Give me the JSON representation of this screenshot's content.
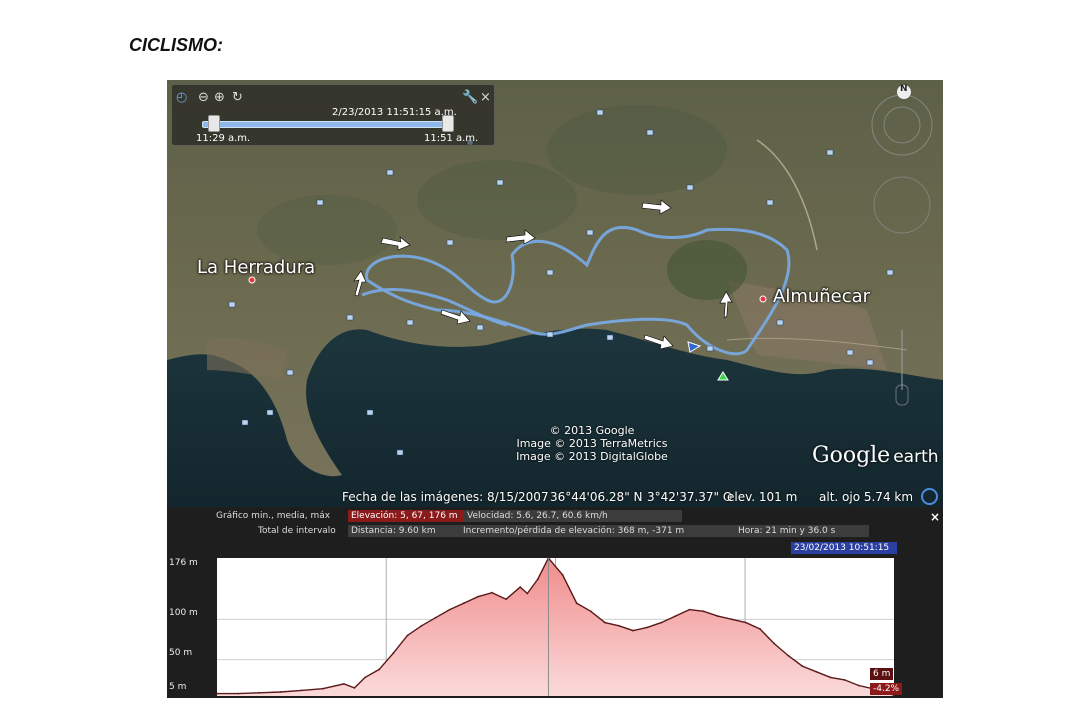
{
  "heading": "CICLISMO:",
  "time_slider": {
    "current": "2/23/2013  11:51:15 a.m.",
    "start": "11:29 a.m.",
    "end": "11:51 a.m."
  },
  "map": {
    "places": [
      "La Herradura",
      "Almuñecar"
    ],
    "copyright": [
      "© 2013 Google",
      "Image © 2013 TerraMetrics",
      "Image © 2013 DigitalGlobe"
    ],
    "logo_word": "Google",
    "logo_earth": "earth",
    "compass": "N",
    "status": {
      "imagery_date": "Fecha de las imágenes: 8/15/2007",
      "lat": "36°44'06.28\" N",
      "lon": "3°42'37.37\" O",
      "elev": "elev.   101 m",
      "eye": "alt. ojo   5.74 km"
    },
    "icons": [
      "zoom-out-icon",
      "zoom-in-icon",
      "zoom-reset-icon",
      "wrench-icon",
      "close-icon"
    ]
  },
  "elevation_panel": {
    "row1_label": "Gráfico  min., media, máx",
    "elevation": "Elevación: 5, 67, 176 m",
    "speed": "Velocidad: 5.6, 26.7, 60.6 km/h",
    "row2_label": "Total de intervalo",
    "distance": "Distancia: 9.60 km",
    "gain_loss": "Incremento/pérdida de elevación: 368 m, -371 m",
    "time": "Hora: 21 min y 36.0 s",
    "timestamp": "23/02/2013 10:51:15",
    "close": "×",
    "y_labels": [
      "176 m",
      "100 m",
      "50 m",
      "5 m"
    ],
    "end_elev": "6 m",
    "end_grade": "-4.2%"
  },
  "chart_data": {
    "type": "area",
    "title": "",
    "xlabel": "",
    "ylabel": "",
    "x_unit": "km",
    "ylim": [
      5,
      176
    ],
    "x": [
      0,
      0.3,
      0.6,
      0.9,
      1.2,
      1.5,
      1.8,
      1.95,
      2.1,
      2.3,
      2.5,
      2.7,
      2.9,
      3.1,
      3.3,
      3.5,
      3.7,
      3.9,
      4.1,
      4.3,
      4.4,
      4.55,
      4.7,
      4.9,
      5.1,
      5.3,
      5.5,
      5.7,
      5.9,
      6.1,
      6.3,
      6.5,
      6.7,
      6.9,
      7.1,
      7.3,
      7.5,
      7.7,
      7.9,
      8.1,
      8.3,
      8.5,
      8.7,
      8.9,
      9.1,
      9.3,
      9.45,
      9.6
    ],
    "y": [
      8,
      8,
      9,
      10,
      12,
      14,
      20,
      15,
      28,
      38,
      58,
      80,
      92,
      102,
      112,
      120,
      128,
      133,
      125,
      140,
      132,
      150,
      176,
      155,
      120,
      110,
      96,
      92,
      86,
      90,
      96,
      104,
      112,
      110,
      104,
      100,
      96,
      88,
      70,
      55,
      42,
      35,
      28,
      25,
      18,
      14,
      10,
      6
    ]
  }
}
